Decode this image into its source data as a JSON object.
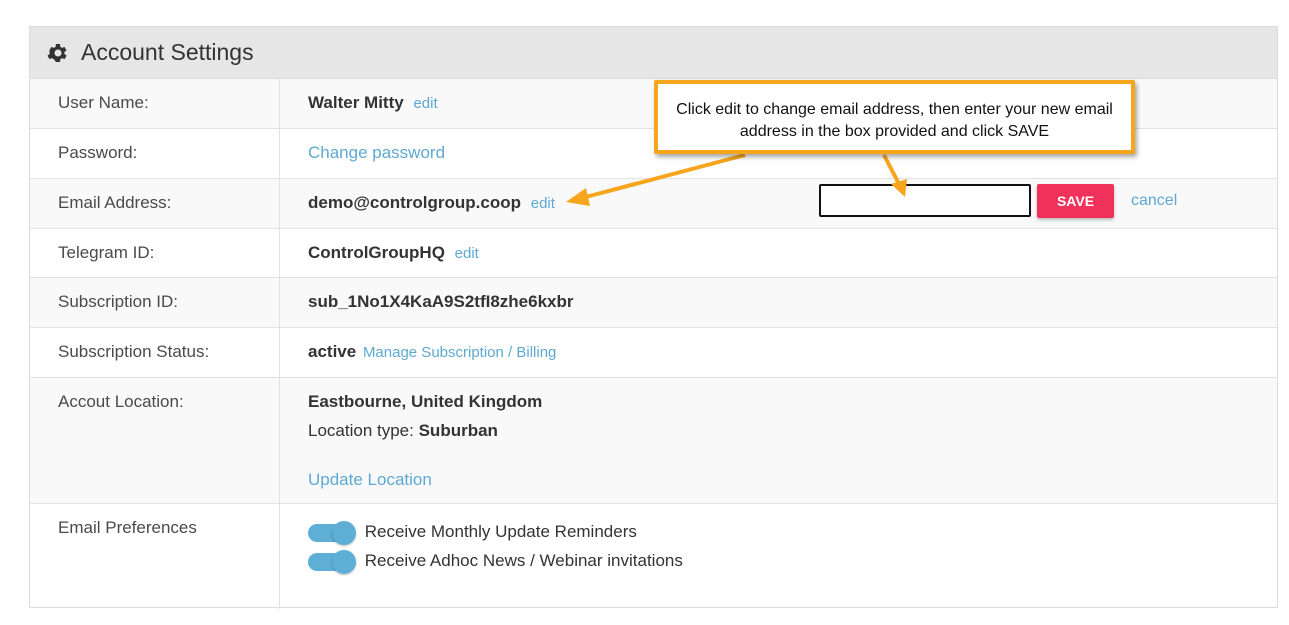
{
  "panel": {
    "title": "Account Settings",
    "icon": "gear-icon"
  },
  "rows": {
    "username": {
      "label": "User Name:",
      "value": "Walter Mitty",
      "action": "edit"
    },
    "password": {
      "label": "Password:",
      "action": "Change password"
    },
    "email": {
      "label": "Email Address:",
      "value": "demo@controlgroup.coop",
      "action": "edit"
    },
    "telegram": {
      "label": "Telegram ID:",
      "value": "ControlGroupHQ",
      "action": "edit"
    },
    "subscription_id": {
      "label": "Subscription ID:",
      "value": "sub_1No1X4KaA9S2tfI8zhe6kxbr"
    },
    "subscription_status": {
      "label": "Subscription Status:",
      "value": "active",
      "action": "Manage Subscription / Billing"
    },
    "location": {
      "label": "Accout Location:",
      "value": "Eastbourne, United Kingdom",
      "type_label": "Location type:",
      "type_value": "Suburban",
      "action": "Update Location"
    },
    "email_prefs": {
      "label": "Email Preferences",
      "options": [
        {
          "label": "Receive Monthly Update Reminders",
          "checked": true
        },
        {
          "label": "Receive Adhoc News / Webinar invitations",
          "checked": true
        }
      ]
    }
  },
  "email_edit": {
    "input_value": "",
    "save_label": "SAVE",
    "cancel_label": "cancel"
  },
  "callout": {
    "text": "Click edit to change email address, then enter your new email address in the box provided and click SAVE"
  },
  "colors": {
    "accent": "#5ea9d2",
    "save": "#f0325a",
    "callout_border": "#f5a61d"
  }
}
